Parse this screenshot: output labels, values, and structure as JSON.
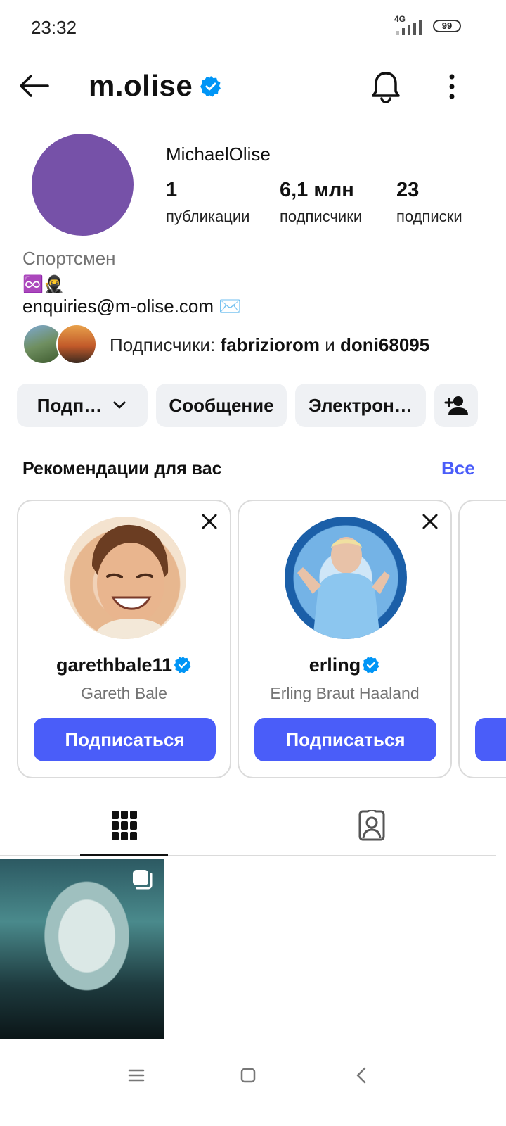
{
  "status_bar": {
    "time": "23:32",
    "network": "4G",
    "battery": "99"
  },
  "header": {
    "username": "m.olise",
    "icons": [
      "arrow-left-icon",
      "verified-badge-icon",
      "bell-icon",
      "more-vertical-icon"
    ]
  },
  "profile": {
    "display_name": "MichaelOlise",
    "avatar_color": "#7651a8",
    "stats": [
      {
        "value": "1",
        "label": "публикации"
      },
      {
        "value": "6,1 млн",
        "label": "подписчики"
      },
      {
        "value": "23",
        "label": "подписки"
      }
    ],
    "category": "Спортсмен",
    "bio_emoji": "♾️🥷",
    "email": "enquiries@m-olise.com ✉️",
    "followed_by": {
      "prefix": "Подписчики: ",
      "user1": "fabriziorom",
      "conj": " и ",
      "user2": "doni68095"
    }
  },
  "actions": {
    "follow_label": "Подп…",
    "message_label": "Сообщение",
    "email_label": "Электрон…"
  },
  "recommendations": {
    "title": "Рекомендации для вас",
    "see_all": "Все",
    "cards": [
      {
        "username": "garethbale11",
        "full_name": "Gareth Bale",
        "button": "Подписаться"
      },
      {
        "username": "erling",
        "full_name": "Erling Braut Haaland",
        "button": "Подписаться"
      }
    ]
  },
  "colors": {
    "accent": "#4a5df9",
    "verified": "#0095f6",
    "muted_text": "#737373",
    "button_bg": "#eff1f4"
  }
}
